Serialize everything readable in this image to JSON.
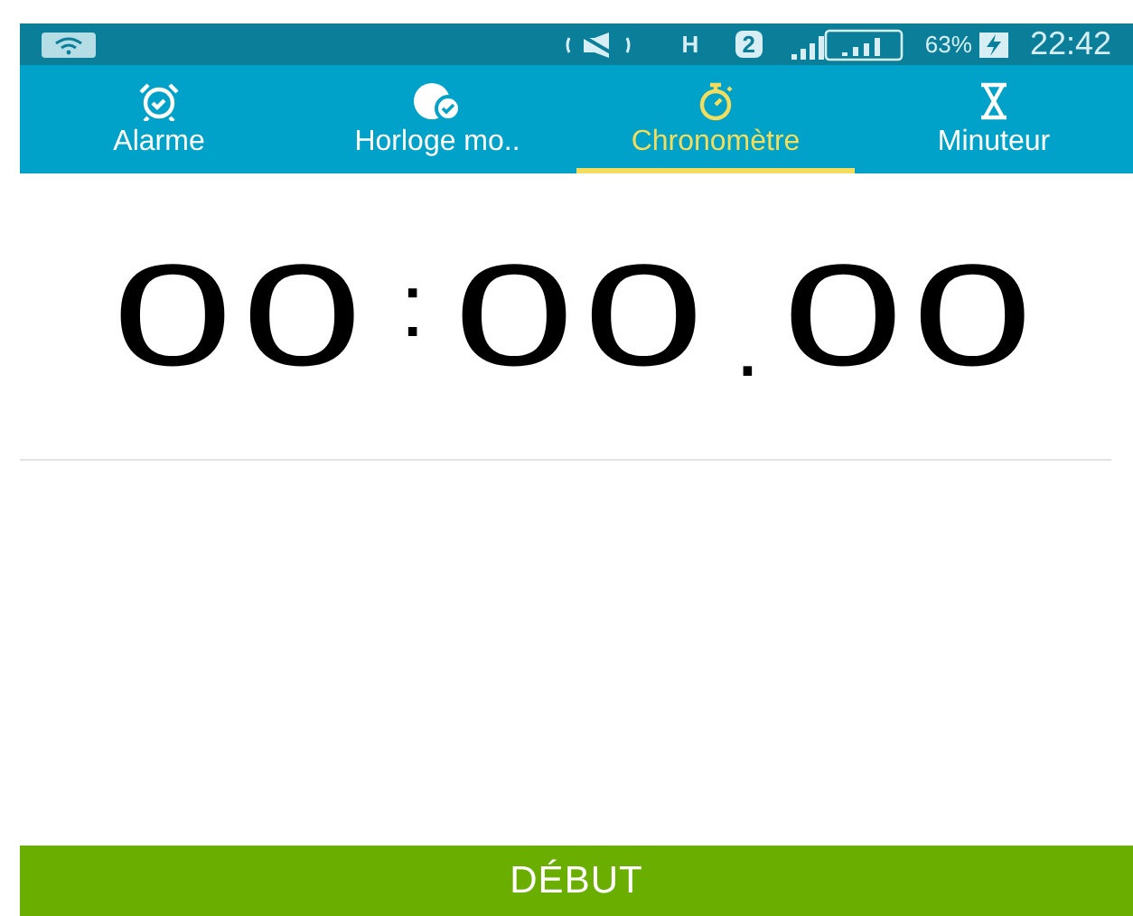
{
  "status_bar": {
    "network": "H",
    "sim": "2",
    "battery": "63%",
    "time": "22:42"
  },
  "tabs": [
    {
      "label": "Alarme",
      "kind": "alarm",
      "selected": false
    },
    {
      "label": "Horloge mo..",
      "kind": "globe",
      "selected": false
    },
    {
      "label": "Chronomètre",
      "kind": "stopwatch",
      "selected": true
    },
    {
      "label": "Minuteur",
      "kind": "hourglass",
      "selected": false
    }
  ],
  "timer": {
    "minutes": "00",
    "sep1": ":",
    "seconds": "00",
    "sep2": ".",
    "hundredths": "00"
  },
  "start_button": "DÉBUT"
}
